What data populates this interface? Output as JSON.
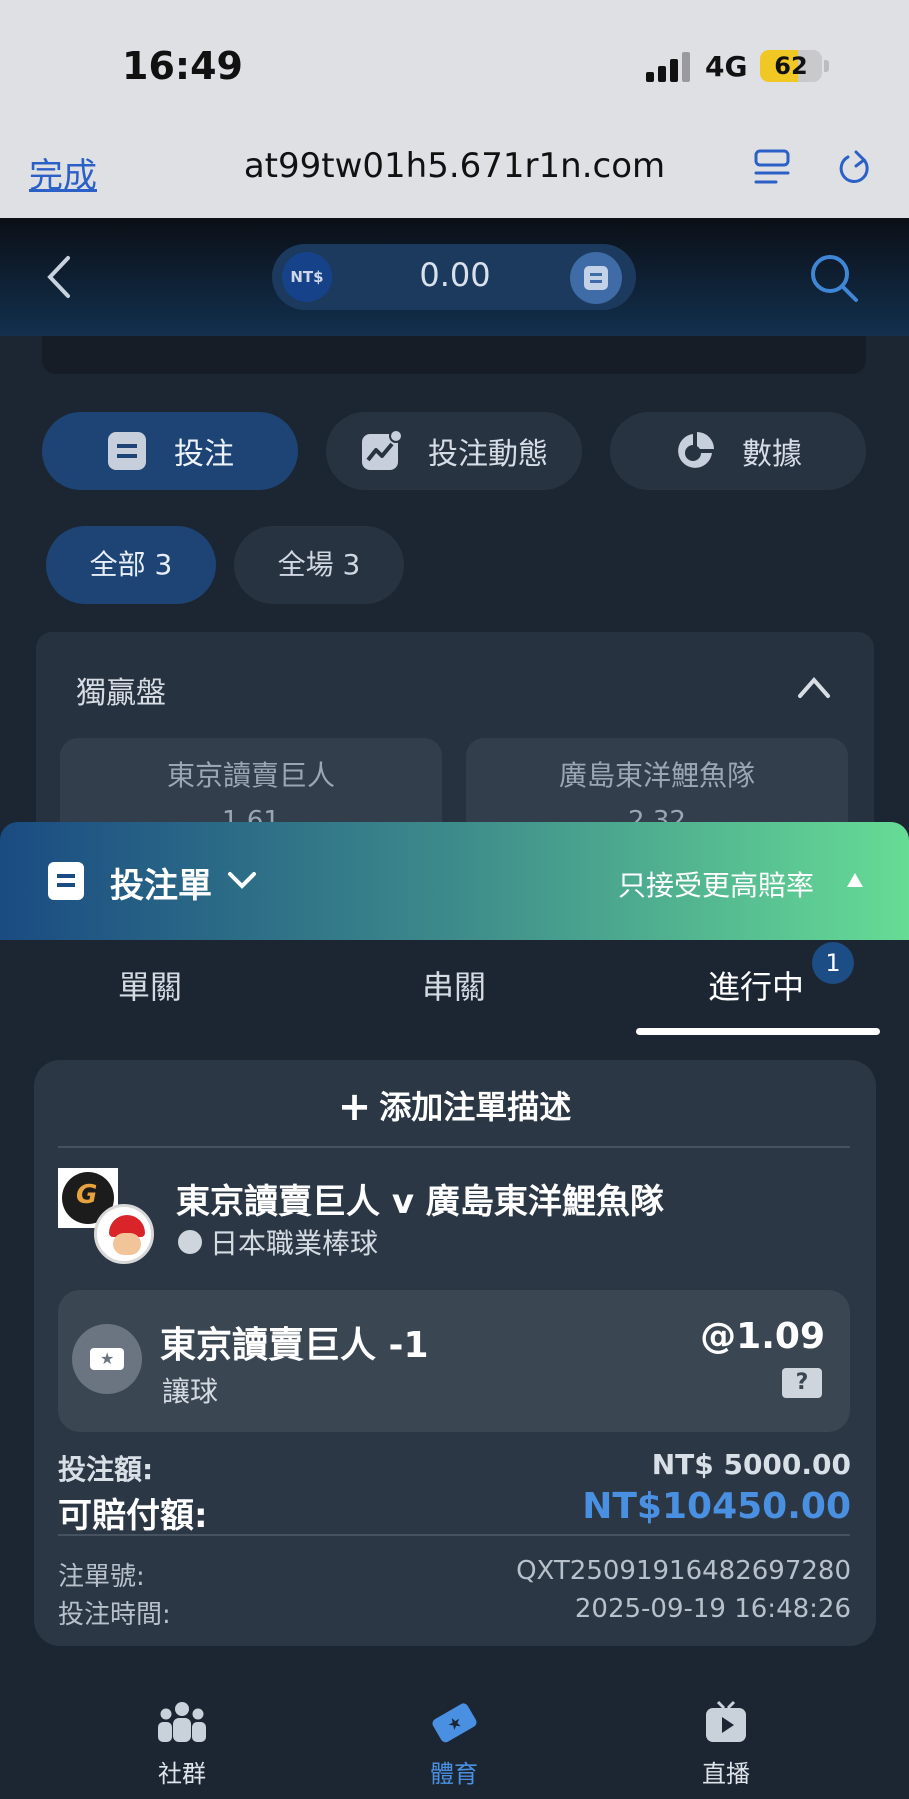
{
  "status_bar": {
    "time": "16:49",
    "network": "4G",
    "battery": "62",
    "battery_fraction": 0.62
  },
  "browser": {
    "done_label": "完成",
    "url": "at99tw01h5.671r1n.com"
  },
  "header": {
    "currency_badge": "NT$",
    "balance": "0.00"
  },
  "main_tabs": [
    {
      "label": "投注"
    },
    {
      "label": "投注動態"
    },
    {
      "label": "數據"
    }
  ],
  "filters": [
    {
      "label": "全部 3"
    },
    {
      "label": "全場 3"
    }
  ],
  "market": {
    "title": "獨贏盤",
    "options": [
      {
        "team": "東京讀賣巨人",
        "odds": "1.61"
      },
      {
        "team": "廣島東洋鯉魚隊",
        "odds": "2.32"
      }
    ]
  },
  "bet_slip": {
    "title": "投注單",
    "odds_preference": "只接受更高賠率",
    "tabs": [
      {
        "label": "單關"
      },
      {
        "label": "串關"
      },
      {
        "label": "進行中"
      }
    ],
    "in_progress_count": "1",
    "add_description": "添加注單描述",
    "match": "東京讀賣巨人 v 廣島東洋鯉魚隊",
    "league": "日本職業棒球",
    "team1_logo_letter": "G",
    "selection": {
      "name": "東京讀賣巨人 -1",
      "market": "讓球",
      "odds": "@1.09",
      "help": "?"
    },
    "stake_label": "投注額:",
    "stake_value": "NT$ 5000.00",
    "payout_label": "可賠付額:",
    "payout_value": "NT$10450.00",
    "ref_label": "注單號:",
    "ref_value": "QXT25091916482697280",
    "time_label": "投注時間:",
    "time_value": "2025-09-19 16:48:26"
  },
  "bottom_nav": [
    {
      "label": "社群"
    },
    {
      "label": "體育"
    },
    {
      "label": "直播"
    }
  ],
  "colors": {
    "accent_blue": "#4a90e2",
    "active_tab_bg": "#1d4474",
    "slip_gradient_start": "#1a4b82",
    "slip_gradient_end": "#66dc95"
  }
}
